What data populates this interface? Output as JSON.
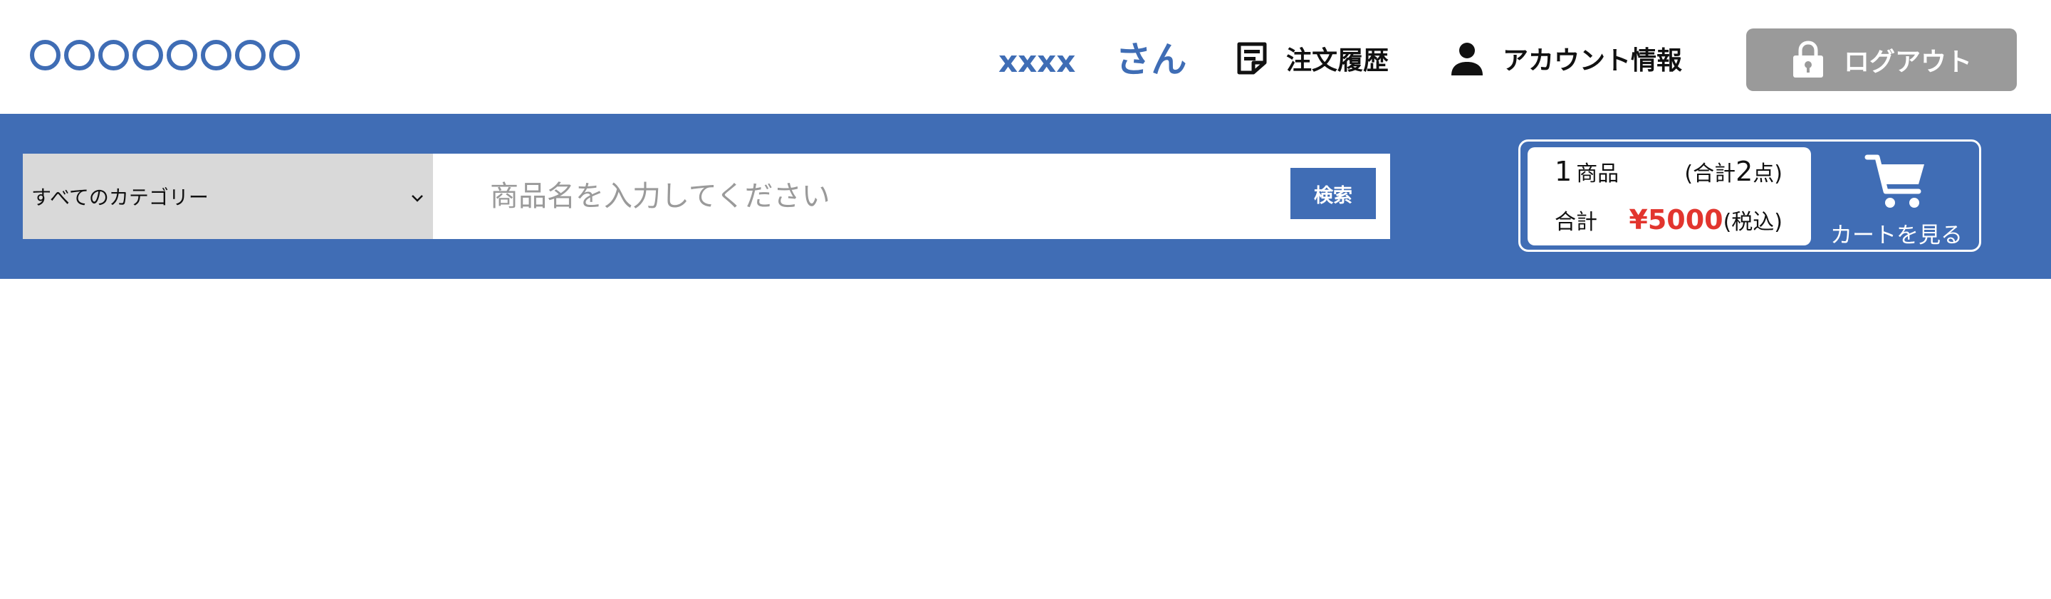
{
  "header": {
    "logo_text": "〇〇〇〇〇〇〇〇",
    "user": {
      "name": "xxxx",
      "suffix": "さん"
    },
    "nav": {
      "orders_label": "注文履歴",
      "orders_icon": "order-history-icon",
      "account_label": "アカウント情報",
      "account_icon": "user-icon"
    },
    "logout": {
      "label": "ログアウト",
      "icon": "lock-icon"
    }
  },
  "search": {
    "category_selected": "すべてのカテゴリー",
    "placeholder": "商品名を入力してください",
    "button_label": "検索"
  },
  "cart": {
    "item_count": "1",
    "item_unit": "商品",
    "total_qty_open": "(合計",
    "total_qty_num": "2",
    "total_qty_close": "点)",
    "total_label": "合計",
    "total_price": "¥5000",
    "tax_note": "(税込)",
    "view_label": "カートを見る",
    "icon": "cart-icon"
  },
  "colors": {
    "brand_blue": "#406db5",
    "price_red": "#e2352e",
    "logout_gray": "#9a9a9a",
    "category_gray": "#d9d9d9"
  }
}
